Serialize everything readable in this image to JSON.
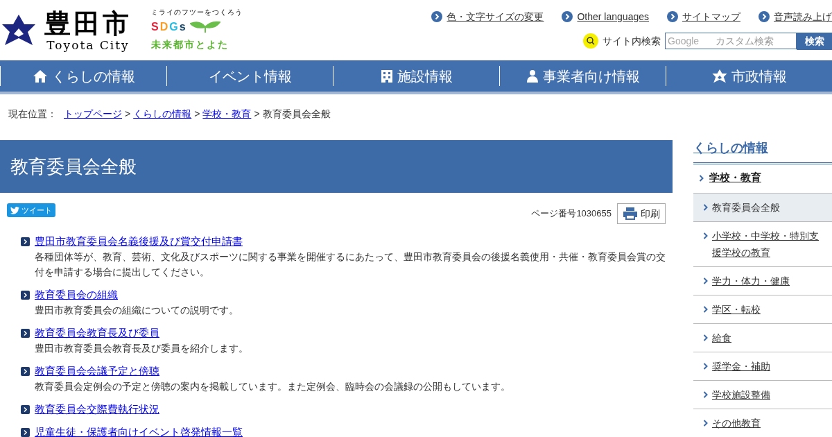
{
  "header": {
    "logo_title": "豊田市",
    "logo_subtitle": "Toyota City",
    "sdgs_tagline": "ミライのフツーをつくろう",
    "sdgs_mark": "SDGs",
    "sdgs_caption": "未来都市とよた",
    "utility_links": [
      "色・文字サイズの変更",
      "Other languages",
      "サイトマップ",
      "音声読み上げ"
    ],
    "search": {
      "label": "サイト内検索",
      "placeholder": "カスタム検索",
      "brand": "Google",
      "button": "検索"
    }
  },
  "nav": [
    {
      "label": "くらしの情報"
    },
    {
      "label": "イベント情報"
    },
    {
      "label": "施設情報"
    },
    {
      "label": "事業者向け情報"
    },
    {
      "label": "市政情報"
    }
  ],
  "breadcrumb": {
    "label": "現在位置：",
    "separator": ">",
    "links": [
      "トップページ",
      "くらしの情報",
      "学校・教育"
    ],
    "current": "教育委員会全般"
  },
  "page": {
    "title": "教育委員会全般",
    "tweet": "ツイート",
    "page_number": "ページ番号1030655",
    "print": "印刷",
    "entries": [
      {
        "link": "豊田市教育委員会名義後援及び賞交付申請書",
        "description": "各種団体等が、教育、芸術、文化及びスポーツに関する事業を開催するにあたって、豊田市教育委員会の後援名義使用・共催・教育委員会賞の交付を申請する場合に提出してください。"
      },
      {
        "link": "教育委員会の組織",
        "description": "豊田市教育委員会の組織についての説明です。"
      },
      {
        "link": "教育委員会教育長及び委員",
        "description": "豊田市教育委員会教育長及び委員を紹介します。"
      },
      {
        "link": "教育委員会会議予定と傍聴",
        "description": "教育委員会定例会の予定と傍聴の案内を掲載しています。また定例会、臨時会の会議録の公開もしています。"
      },
      {
        "link": "教育委員会交際費執行状況"
      },
      {
        "link": "児童生徒・保護者向けイベント啓発情報一覧"
      }
    ]
  },
  "sidebar": {
    "title": "くらしの情報",
    "items": [
      {
        "label": "学校・教育",
        "children": [
          {
            "label": "教育委員会全般",
            "selected": true
          },
          {
            "label": "小学校・中学校・特別支援学校の教育",
            "selected": false
          },
          {
            "label": "学力・体力・健康",
            "selected": false
          },
          {
            "label": "学区・転校",
            "selected": false
          },
          {
            "label": "給食",
            "selected": false
          },
          {
            "label": "奨学金・補助",
            "selected": false
          },
          {
            "label": "学校施設整備",
            "selected": false
          },
          {
            "label": "その他教育",
            "selected": false
          }
        ]
      }
    ]
  }
}
